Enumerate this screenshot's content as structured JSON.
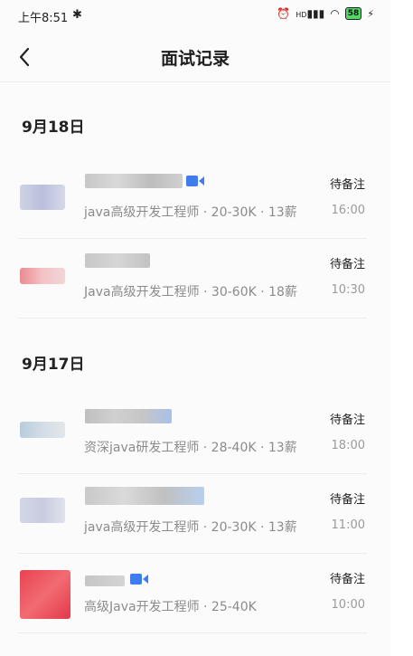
{
  "status_bar": {
    "time": "上午8:51",
    "bluetooth": "bluetooth-icon",
    "alarm": "alarm-icon",
    "signal": "HD",
    "wifi": "wifi-icon",
    "battery": "58",
    "charging": "⚡"
  },
  "nav": {
    "back": "‹",
    "title": "面试记录"
  },
  "groups": [
    {
      "date": "9月18日"
    },
    {
      "date": "9月17日"
    }
  ],
  "records": [
    {
      "status": "待备注",
      "job": "java高级开发工程师 · 20-30K · 13薪",
      "time": "16:00",
      "has_video": true
    },
    {
      "status": "待备注",
      "job": "Java高级开发工程师 · 30-60K · 18薪",
      "time": "10:30",
      "has_video": false
    },
    {
      "status": "待备注",
      "job": "资深java研发工程师 · 28-40K · 13薪",
      "time": "18:00",
      "has_video": false
    },
    {
      "status": "待备注",
      "job": "java高级开发工程师 · 20-30K · 13薪",
      "time": "11:00",
      "has_video": false
    },
    {
      "status": "待备注",
      "job": "高级Java开发工程师 · 25-40K",
      "time": "10:00",
      "has_video": true
    }
  ],
  "colors": {
    "accent": "#3f7cf2",
    "divider": "#ededed",
    "secondary_text": "#8b8b8b"
  }
}
